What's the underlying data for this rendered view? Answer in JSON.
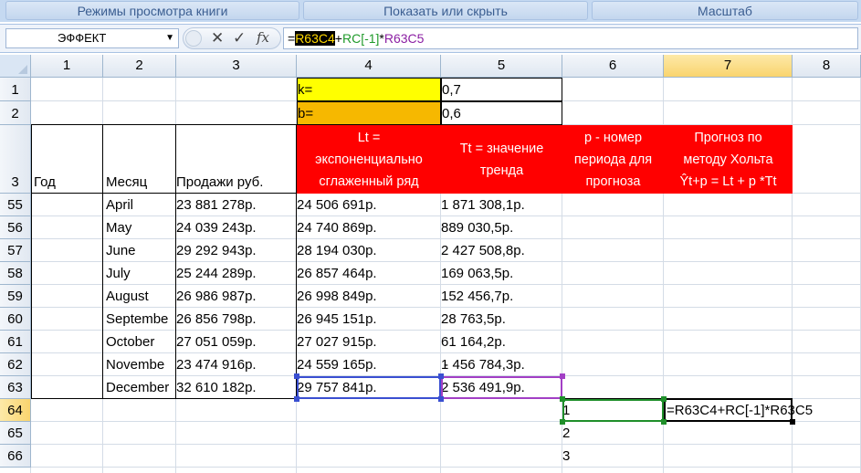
{
  "ribbon": {
    "groups": [
      "Режимы просмотра книги",
      "Показать или скрыть",
      "Масштаб"
    ]
  },
  "formula_bar": {
    "name_box": "ЭФФЕКТ",
    "icons": [
      "cancel-icon",
      "enter-icon",
      "fx-icon"
    ],
    "cancel_glyph": "✕",
    "enter_glyph": "✓",
    "fx_glyph": "fx",
    "formula_eq": "=",
    "formula_ref1": "R63C4",
    "formula_plus": "+",
    "formula_ref2": "RC[-1]",
    "formula_mul": "*",
    "formula_ref3": "R63C5"
  },
  "columns": [
    "1",
    "2",
    "3",
    "4",
    "5",
    "6",
    "7",
    "8"
  ],
  "rows": [
    "1",
    "2",
    "3",
    "55",
    "56",
    "57",
    "58",
    "59",
    "60",
    "61",
    "62",
    "63",
    "64",
    "65",
    "66"
  ],
  "params": {
    "k_label": "k=",
    "k_value": "0,7",
    "b_label": "b=",
    "b_value": "0,6"
  },
  "table_headers": {
    "year": "Год",
    "month": "Месяц",
    "sales": "Продажи руб.",
    "lt": "Lt =\nэкспоненциально\nсглаженный ряд",
    "tt": "Tt = значение\nтренда",
    "p": "p - номер\nпериода для\nпрогноза",
    "forecast": "Прогноз по\nметоду Хольта\nŶt+p = Lt + p *Tt"
  },
  "data_rows": [
    {
      "month": "April",
      "sales": "23 881 278р.",
      "lt": "24 506 691р.",
      "tt": "1 871 308,1р."
    },
    {
      "month": "May",
      "sales": "24 039 243р.",
      "lt": "24 740 869р.",
      "tt": "889 030,5р."
    },
    {
      "month": "June",
      "sales": "29 292 943р.",
      "lt": "28 194 030р.",
      "tt": "2 427 508,8р."
    },
    {
      "month": "July",
      "sales": "25 244 289р.",
      "lt": "26 857 464р.",
      "tt": "169 063,5р."
    },
    {
      "month": "August",
      "sales": "26 986 987р.",
      "lt": "26 998 849р.",
      "tt": "152 456,7р."
    },
    {
      "month": "Septembe",
      "sales": "26 856 798р.",
      "lt": "26 945 151р.",
      "tt": "28 763,5р."
    },
    {
      "month": "October",
      "sales": "27 051 059р.",
      "lt": "27 027 915р.",
      "tt": "61 164,2р."
    },
    {
      "month": "Novembe",
      "sales": "23 474 916р.",
      "lt": "24 559 165р.",
      "tt": "1 456 784,3р.",
      "tt_prefix": "-"
    },
    {
      "month": "December",
      "sales": "32 610 182р.",
      "lt": "29 757 841р.",
      "tt": "2 536 491,9р."
    }
  ],
  "forecast_rows": [
    {
      "p": "1",
      "formula": "=R63C4+RC[-1]*R63C5"
    },
    {
      "p": "2",
      "formula": ""
    },
    {
      "p": "3",
      "formula": ""
    }
  ],
  "colors": {
    "header_red": "#ff0000",
    "k_yellow": "#ffff00",
    "b_orange": "#f6b800",
    "selection_blue": "#3a4fd1",
    "selection_purple": "#a23fc5",
    "selection_green": "#1f8f2a"
  }
}
